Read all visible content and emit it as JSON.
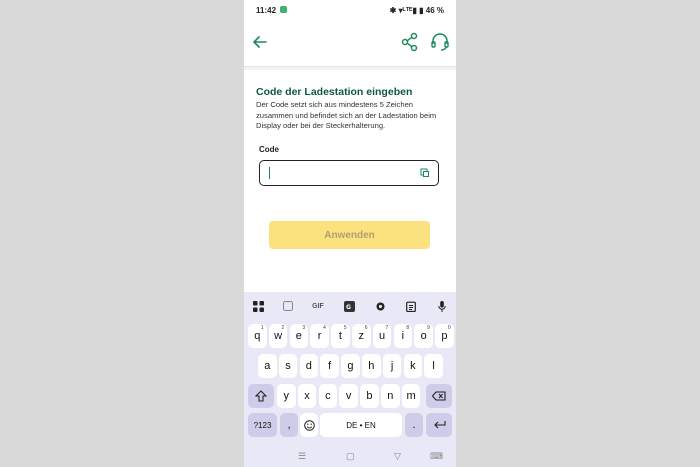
{
  "status_bar": {
    "time": "11:42",
    "right": "✱ ▾ᴸᵀᴱ▮ ▮ 46 %"
  },
  "app_bar": {
    "back_icon": "arrow-left-icon",
    "share_icon": "share-icon",
    "support_icon": "headset-icon",
    "accent": "#1a8a5a"
  },
  "content": {
    "title": "Code der Ladestation eingeben",
    "description": "Der Code setzt sich aus mindestens 5 Zeichen zusammen und befindet sich an der Ladestation beim Display oder bei der Steckerhalterung.",
    "code_label": "Code",
    "code_value": "",
    "apply_label": "Anwenden",
    "apply_color": "#fbe27e"
  },
  "keyboard": {
    "toolbar": [
      "apps-icon",
      "sticker-icon",
      "GIF",
      "translate-icon",
      "gear-icon",
      "clipboard-icon",
      "mic-icon"
    ],
    "gif_label": "GIF",
    "row1": [
      {
        "k": "q",
        "h": "1"
      },
      {
        "k": "w",
        "h": "2"
      },
      {
        "k": "e",
        "h": "3"
      },
      {
        "k": "r",
        "h": "4"
      },
      {
        "k": "t",
        "h": "5"
      },
      {
        "k": "z",
        "h": "6"
      },
      {
        "k": "u",
        "h": "7"
      },
      {
        "k": "i",
        "h": "8"
      },
      {
        "k": "o",
        "h": "9"
      },
      {
        "k": "p",
        "h": "0"
      }
    ],
    "row2": [
      "a",
      "s",
      "d",
      "f",
      "g",
      "h",
      "j",
      "k",
      "l"
    ],
    "row3": [
      "y",
      "x",
      "c",
      "v",
      "b",
      "n",
      "m"
    ],
    "symbols_label": "?123",
    "comma_label": ",",
    "space_label": "DE • EN",
    "period_label": ".",
    "shift_icon": "shift-icon",
    "backspace_icon": "backspace-icon",
    "enter_icon": "enter-icon",
    "emoji_icon": "emoji-icon"
  },
  "nav": {
    "menu_icon": "☰",
    "home_icon": "▢",
    "back_icon": "▽",
    "keyboard_icon": "⌨"
  }
}
